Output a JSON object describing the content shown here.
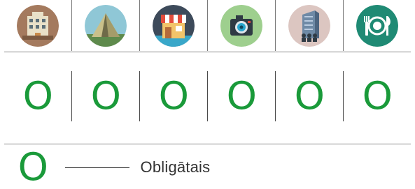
{
  "icons": [
    {
      "icon": "hotel-building-icon"
    },
    {
      "icon": "tent-camping-icon"
    },
    {
      "icon": "shop-store-icon"
    },
    {
      "icon": "camera-icon"
    },
    {
      "icon": "office-building-people-icon"
    },
    {
      "icon": "plate-cutlery-icon"
    }
  ],
  "marks": [
    "O",
    "O",
    "O",
    "O",
    "O",
    "O"
  ],
  "legend": {
    "symbol": "O",
    "label": "Obligātais"
  },
  "colors": {
    "mark": "#1a9a3a"
  }
}
